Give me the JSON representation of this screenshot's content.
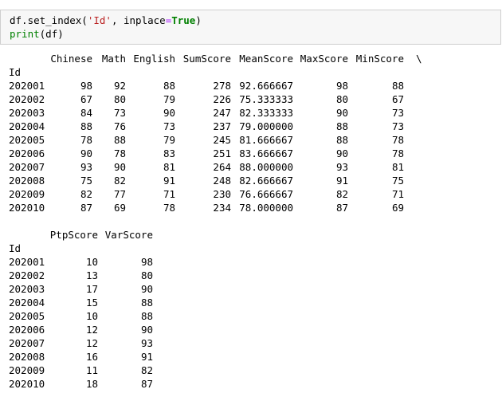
{
  "code": {
    "line1": {
      "prefix": "df.set_index(",
      "str": "'Id'",
      "mid": ", inplace",
      "op": "=",
      "kw": "True",
      "suffix": ")"
    },
    "line2": {
      "builtin": "print",
      "rest": "(df)"
    }
  },
  "output": {
    "block1": {
      "headers": [
        "Chinese",
        "Math",
        "English",
        "SumScore",
        "MeanScore",
        "MaxScore",
        "MinScore"
      ],
      "continuation": "\\",
      "index_name": "Id",
      "rows": [
        {
          "id": "202001",
          "cells": [
            "98",
            "92",
            "88",
            "278",
            "92.666667",
            "98",
            "88"
          ]
        },
        {
          "id": "202002",
          "cells": [
            "67",
            "80",
            "79",
            "226",
            "75.333333",
            "80",
            "67"
          ]
        },
        {
          "id": "202003",
          "cells": [
            "84",
            "73",
            "90",
            "247",
            "82.333333",
            "90",
            "73"
          ]
        },
        {
          "id": "202004",
          "cells": [
            "88",
            "76",
            "73",
            "237",
            "79.000000",
            "88",
            "73"
          ]
        },
        {
          "id": "202005",
          "cells": [
            "78",
            "88",
            "79",
            "245",
            "81.666667",
            "88",
            "78"
          ]
        },
        {
          "id": "202006",
          "cells": [
            "90",
            "78",
            "83",
            "251",
            "83.666667",
            "90",
            "78"
          ]
        },
        {
          "id": "202007",
          "cells": [
            "93",
            "90",
            "81",
            "264",
            "88.000000",
            "93",
            "81"
          ]
        },
        {
          "id": "202008",
          "cells": [
            "75",
            "82",
            "91",
            "248",
            "82.666667",
            "91",
            "75"
          ]
        },
        {
          "id": "202009",
          "cells": [
            "82",
            "77",
            "71",
            "230",
            "76.666667",
            "82",
            "71"
          ]
        },
        {
          "id": "202010",
          "cells": [
            "87",
            "69",
            "78",
            "234",
            "78.000000",
            "87",
            "69"
          ]
        }
      ]
    },
    "block2": {
      "headers": [
        "PtpScore",
        "VarScore"
      ],
      "index_name": "Id",
      "rows": [
        {
          "id": "202001",
          "cells": [
            "10",
            "98"
          ]
        },
        {
          "id": "202002",
          "cells": [
            "13",
            "80"
          ]
        },
        {
          "id": "202003",
          "cells": [
            "17",
            "90"
          ]
        },
        {
          "id": "202004",
          "cells": [
            "15",
            "88"
          ]
        },
        {
          "id": "202005",
          "cells": [
            "10",
            "88"
          ]
        },
        {
          "id": "202006",
          "cells": [
            "12",
            "90"
          ]
        },
        {
          "id": "202007",
          "cells": [
            "12",
            "93"
          ]
        },
        {
          "id": "202008",
          "cells": [
            "16",
            "91"
          ]
        },
        {
          "id": "202009",
          "cells": [
            "11",
            "82"
          ]
        },
        {
          "id": "202010",
          "cells": [
            "18",
            "87"
          ]
        }
      ]
    }
  }
}
